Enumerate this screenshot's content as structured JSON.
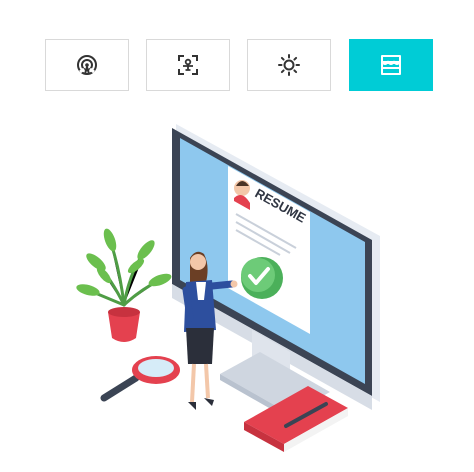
{
  "tabs": [
    {
      "label": "",
      "icon": "wireless-signal-icon",
      "active": false
    },
    {
      "label": "",
      "icon": "scan-person-icon",
      "active": false
    },
    {
      "label": "",
      "icon": "sun-icon",
      "active": false
    },
    {
      "label": "",
      "icon": "storefront-icon",
      "active": true
    }
  ],
  "illustration": {
    "document_heading": "RESUME"
  },
  "colors": {
    "accent": "#00ccd6",
    "tab_border": "#d9d9d9",
    "icon": "#333333",
    "icon_active": "#ffffff",
    "screen_blue": "#8ec8ee",
    "check_green": "#5fc36b",
    "book_red": "#e4414f",
    "suit_blue": "#2d4f9e"
  }
}
